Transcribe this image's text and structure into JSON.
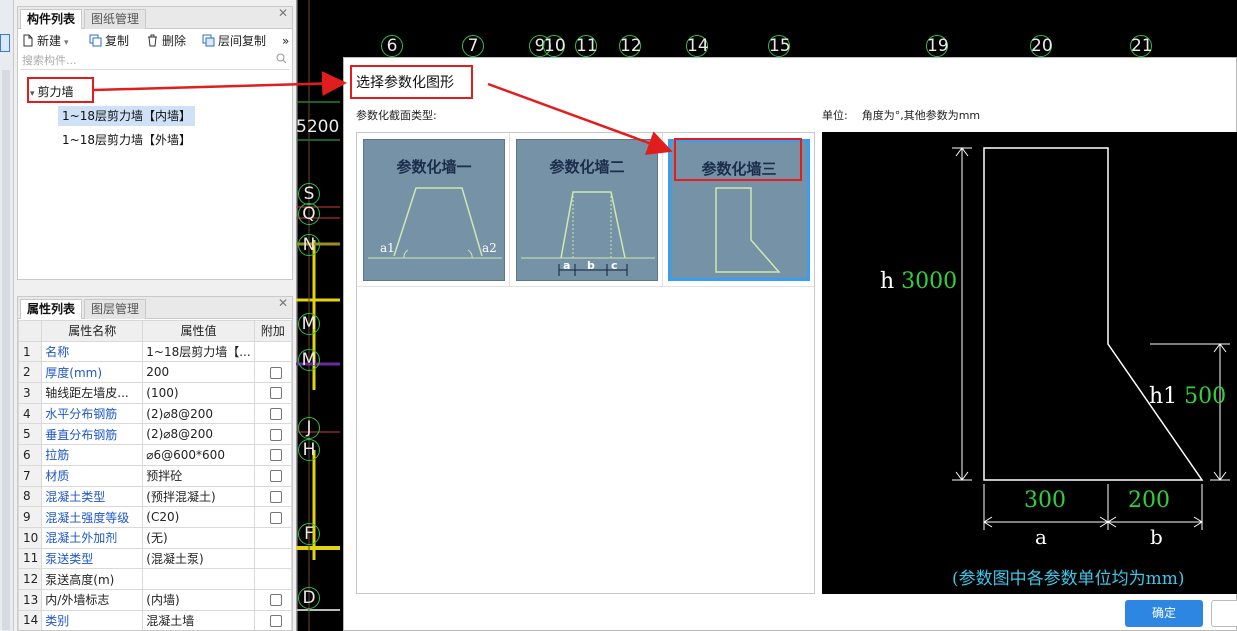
{
  "left_top": {
    "tabs": [
      "构件列表",
      "图纸管理"
    ],
    "toolbar": {
      "new": "新建",
      "copy": "复制",
      "delete": "删除",
      "floor_copy": "层间复制",
      "more": "»"
    },
    "search_placeholder": "搜索构件...",
    "tree": {
      "root": "剪力墙",
      "items": [
        "1~18层剪力墙【内墙】",
        "1~18层剪力墙【外墙】"
      ]
    }
  },
  "props": {
    "tabs": [
      "属性列表",
      "图层管理"
    ],
    "headers": [
      "属性名称",
      "属性值",
      "附加"
    ],
    "rows": [
      {
        "n": "1",
        "name": "名称",
        "value": "1~18层剪力墙【..."
      },
      {
        "n": "2",
        "name": "厚度(mm)",
        "value": "200"
      },
      {
        "n": "3",
        "name": "轴线距左墙皮...",
        "value": "(100)"
      },
      {
        "n": "4",
        "name": "水平分布钢筋",
        "value": "(2)⌀8@200"
      },
      {
        "n": "5",
        "name": "垂直分布钢筋",
        "value": "(2)⌀8@200"
      },
      {
        "n": "6",
        "name": "拉筋",
        "value": "⌀6@600*600"
      },
      {
        "n": "7",
        "name": "材质",
        "value": "预拌砼"
      },
      {
        "n": "8",
        "name": "混凝土类型",
        "value": "(预拌混凝土)"
      },
      {
        "n": "9",
        "name": "混凝土强度等级",
        "value": "(C20)"
      },
      {
        "n": "10",
        "name": "混凝土外加剂",
        "value": "(无)"
      },
      {
        "n": "11",
        "name": "泵送类型",
        "value": "(混凝土泵)"
      },
      {
        "n": "12",
        "name": "泵送高度(m)",
        "value": ""
      },
      {
        "n": "13",
        "name": "内/外墙标志",
        "value": "(内墙)"
      },
      {
        "n": "14",
        "name": "类别",
        "value": "混凝土墙"
      }
    ]
  },
  "cad": {
    "col_axes": [
      "6",
      "7",
      "9",
      "10",
      "11",
      "12",
      "14",
      "15",
      "19",
      "20",
      "21"
    ],
    "row_axes": [
      "S",
      "Q",
      "N",
      "M",
      "M",
      "J",
      "H",
      "F",
      "D"
    ],
    "dim_text": "5200"
  },
  "dialog": {
    "title": "选择参数化图形",
    "section_label": "参数化截面类型:",
    "unit_label": "单位:",
    "unit_text": "角度为°,其他参数为mm",
    "thumbs": [
      {
        "title": "参数化墙一",
        "labels": [
          "a1",
          "a2"
        ]
      },
      {
        "title": "参数化墙二",
        "labels": [
          "a",
          "b",
          "c"
        ]
      },
      {
        "title": "参数化墙三"
      }
    ],
    "preview": {
      "h_label": "h",
      "h_value": "3000",
      "h1_label": "h1",
      "h1_value": "500",
      "a_value": "300",
      "a_label": "a",
      "b_value": "200",
      "b_label": "b",
      "note": "(参数图中各参数单位均为mm)"
    },
    "ok_label": "确定"
  },
  "colors": {
    "accent": "#2d87e2",
    "highlight": "#e21d1d",
    "dim_green": "#2fd23a",
    "note_cyan": "#3cc6e8"
  }
}
